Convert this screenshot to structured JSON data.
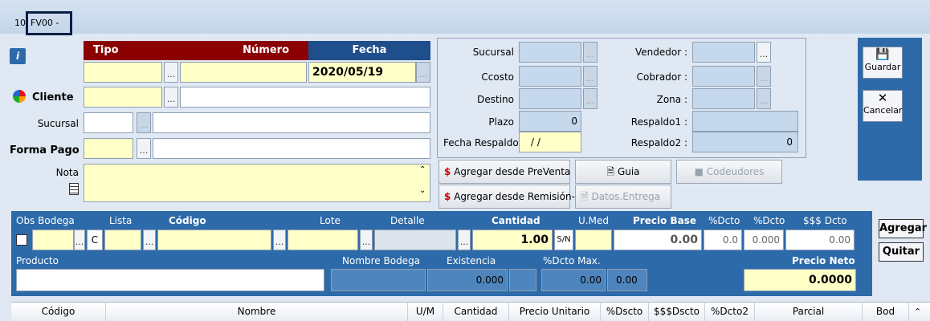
{
  "title_bar": {
    "code_prefix": "10",
    "doc_code": "FV00 -"
  },
  "header": {
    "tipo": "Tipo",
    "numero": "Número",
    "fecha": "Fecha",
    "fecha_value": "2020/05/19"
  },
  "left": {
    "cliente": "Cliente",
    "sucursal": "Sucursal",
    "forma_pago": "Forma Pago",
    "nota": "Nota"
  },
  "middle": {
    "sucursal": "Sucursal",
    "ccosto": "Ccosto",
    "destino": "Destino",
    "plazo": "Plazo",
    "plazo_value": "0",
    "fecha_respaldo": "Fecha Respaldo",
    "fecha_respaldo_value": "/ /",
    "vendedor": "Vendedor :",
    "cobrador": "Cobrador :",
    "zona": "Zona :",
    "respaldo1": "Respaldo1 :",
    "respaldo2": "Respaldo2 :",
    "respaldo2_value": "0"
  },
  "actions": {
    "preventa": "Agregar desde PreVenta",
    "guia": "Guia",
    "codeudores": "Codeudores",
    "remision": "Agregar desde Remisión-",
    "datos_entrega": "Datos.Entrega"
  },
  "side_buttons": {
    "guardar": "Guardar",
    "cancelar": "Cancelar"
  },
  "detail": {
    "obs_bodega": "Obs Bodega",
    "lista": "Lista",
    "lista_value": "C",
    "codigo": "Código",
    "lote": "Lote",
    "detalle": "Detalle",
    "cantidad": "Cantidad",
    "cantidad_value": "1.00",
    "sn": "S/N",
    "umed": "U.Med",
    "precio_base": "Precio Base",
    "precio_base_value": "0.00",
    "dcto1": "%Dcto",
    "dcto1_value": "0.0",
    "dcto2": "%Dcto",
    "dcto2_value": "0.000",
    "money_dcto": "$$$ Dcto",
    "money_dcto_value": "0.00",
    "producto": "Producto",
    "nombre_bodega": "Nombre Bodega",
    "existencia": "Existencia",
    "existencia_value": "0.000",
    "dcto_max": "%Dcto Max.",
    "dcto_max_value": "0.00",
    "extra_value": "0.00",
    "precio_neto": "Precio Neto",
    "precio_neto_value": "0.0000",
    "agregar": "Agregar",
    "quitar": "Quitar"
  },
  "grid_columns": [
    "Código",
    "Nombre",
    "U/M",
    "Cantidad",
    "Precio Unitario",
    "%Dscto",
    "$$$Dscto",
    "%Dcto2",
    "Parcial",
    "Bod"
  ],
  "colors": {
    "header_red": "#8b0000",
    "header_blue": "#1f4e8c",
    "side_panel": "#2d6aa9",
    "field_yellow": "#ffffc8"
  }
}
